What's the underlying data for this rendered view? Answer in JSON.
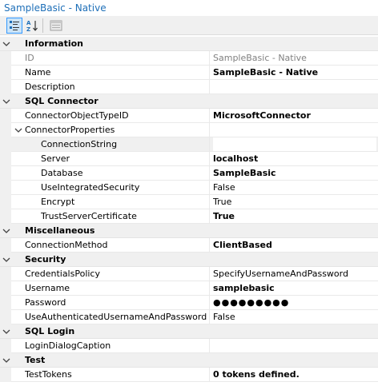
{
  "window": {
    "title": "SampleBasic - Native"
  },
  "toolbar": {
    "buttons": [
      {
        "icon": "categorized-icon",
        "active": true
      },
      {
        "icon": "alphabetical-sort-icon",
        "active": false
      },
      {
        "icon": "property-pages-icon",
        "active": false
      }
    ]
  },
  "categories": {
    "information": "Information",
    "sql_connector": "SQL Connector",
    "miscellaneous": "Miscellaneous",
    "security": "Security",
    "sql_login": "SQL Login",
    "test": "Test"
  },
  "properties": {
    "id": {
      "name": "ID",
      "value": "SampleBasic - Native"
    },
    "name": {
      "name": "Name",
      "value": "SampleBasic - Native"
    },
    "description": {
      "name": "Description",
      "value": ""
    },
    "connector_object_type_id": {
      "name": "ConnectorObjectTypeID",
      "value": "MicrosoftConnector"
    },
    "connector_properties": {
      "name": "ConnectorProperties",
      "value": ""
    },
    "connection_string": {
      "name": "ConnectionString",
      "value": ""
    },
    "server": {
      "name": "Server",
      "value": "localhost"
    },
    "database": {
      "name": "Database",
      "value": "SampleBasic"
    },
    "use_integrated_security": {
      "name": "UseIntegratedSecurity",
      "value": "False"
    },
    "encrypt": {
      "name": "Encrypt",
      "value": "True"
    },
    "trust_server_certificate": {
      "name": "TrustServerCertificate",
      "value": "True"
    },
    "connection_method": {
      "name": "ConnectionMethod",
      "value": "ClientBased"
    },
    "credentials_policy": {
      "name": "CredentialsPolicy",
      "value": "SpecifyUsernameAndPassword"
    },
    "username": {
      "name": "Username",
      "value": "samplebasic"
    },
    "password": {
      "name": "Password",
      "value": "●●●●●●●●●"
    },
    "use_authenticated": {
      "name": "UseAuthenticatedUsernameAndPassword",
      "value": "False"
    },
    "login_dialog_caption": {
      "name": "LoginDialogCaption",
      "value": ""
    },
    "test_tokens": {
      "name": "TestTokens",
      "value": "0 tokens defined."
    }
  }
}
